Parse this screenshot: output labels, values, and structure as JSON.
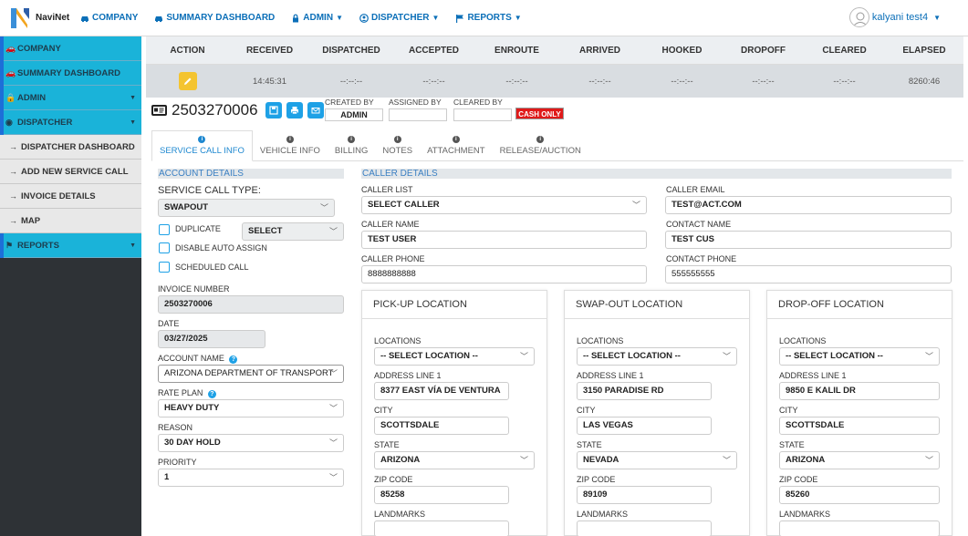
{
  "brand": {
    "name": "NaviNet"
  },
  "topnav": {
    "items": [
      {
        "label": "COMPANY",
        "icon": "car-icon",
        "dropdown": false
      },
      {
        "label": "SUMMARY DASHBOARD",
        "icon": "car-icon",
        "dropdown": false
      },
      {
        "label": "ADMIN",
        "icon": "lock-icon",
        "dropdown": true
      },
      {
        "label": "DISPATCHER",
        "icon": "user-circle-icon",
        "dropdown": true
      },
      {
        "label": "REPORTS",
        "icon": "flag-icon",
        "dropdown": true
      }
    ],
    "user": "kalyani test4"
  },
  "sidebar": {
    "items": [
      {
        "label": "COMPANY",
        "type": "main",
        "caret": false
      },
      {
        "label": "SUMMARY DASHBOARD",
        "type": "main",
        "caret": false
      },
      {
        "label": "ADMIN",
        "type": "main",
        "caret": true
      },
      {
        "label": "DISPATCHER",
        "type": "main",
        "caret": true
      },
      {
        "label": "DISPATCHER DASHBOARD",
        "type": "sub"
      },
      {
        "label": "ADD NEW SERVICE CALL",
        "type": "sub"
      },
      {
        "label": "INVOICE DETAILS",
        "type": "sub"
      },
      {
        "label": "MAP",
        "type": "sub"
      },
      {
        "label": "REPORTS",
        "type": "main",
        "caret": true
      }
    ]
  },
  "status_table": {
    "headers": [
      "ACTION",
      "RECEIVED",
      "DISPATCHED",
      "ACCEPTED",
      "ENROUTE",
      "ARRIVED",
      "HOOKED",
      "DROPOFF",
      "CLEARED",
      "ELAPSED"
    ],
    "row": [
      "",
      "14:45:31",
      "--:--:--",
      "--:--:--",
      "--:--:--",
      "--:--:--",
      "--:--:--",
      "--:--:--",
      "--:--:--",
      "8260:46"
    ]
  },
  "call": {
    "number": "2503270006",
    "created_by_label": "CREATED BY",
    "created_by": "ADMIN",
    "assigned_by_label": "ASSIGNED BY",
    "assigned_by": "",
    "cleared_by_label": "CLEARED BY",
    "cleared_by": "",
    "cash_badge": "CASH ONLY"
  },
  "tabs": [
    "SERVICE CALL INFO",
    "VEHICLE INFO",
    "BILLING",
    "NOTES",
    "ATTACHMENT",
    "RELEASE/AUCTION"
  ],
  "account": {
    "title": "ACCOUNT DETAILS",
    "service_call_type_label": "SERVICE CALL TYPE:",
    "service_call_type": "SWAPOUT",
    "duplicate_label": "DUPLICATE",
    "duplicate_select": "SELECT",
    "disable_auto_assign_label": "DISABLE AUTO ASSIGN",
    "scheduled_call_label": "SCHEDULED CALL",
    "invoice_number_label": "INVOICE NUMBER",
    "invoice_number": "2503270006",
    "date_label": "DATE",
    "date": "03/27/2025",
    "account_name_label": "ACCOUNT NAME",
    "account_name": "ARIZONA DEPARTMENT OF TRANSPORT",
    "rate_plan_label": "RATE PLAN",
    "rate_plan": "HEAVY DUTY",
    "reason_label": "REASON",
    "reason": "30 DAY HOLD",
    "priority_label": "PRIORITY",
    "priority": "1"
  },
  "caller": {
    "title": "CALLER DETAILS",
    "caller_list_label": "CALLER LIST",
    "caller_list": "SELECT CALLER",
    "caller_email_label": "CALLER EMAIL",
    "caller_email": "TEST@ACT.COM",
    "caller_name_label": "CALLER NAME",
    "caller_name": "TEST USER",
    "contact_name_label": "CONTACT NAME",
    "contact_name": "TEST CUS",
    "caller_phone_label": "CALLER PHONE",
    "caller_phone": "8888888888",
    "contact_phone_label": "CONTACT PHONE",
    "contact_phone": "555555555"
  },
  "locations": [
    {
      "title": "PICK-UP LOCATION",
      "locations_label": "LOCATIONS",
      "locations": "-- SELECT LOCATION --",
      "address_label": "ADDRESS LINE 1",
      "address": "8377 EAST VÍA DE VENTURA",
      "city_label": "CITY",
      "city": "SCOTTSDALE",
      "state_label": "STATE",
      "state": "ARIZONA",
      "zip_label": "ZIP CODE",
      "zip": "85258",
      "landmarks_label": "LANDMARKS"
    },
    {
      "title": "SWAP-OUT LOCATION",
      "locations_label": "LOCATIONS",
      "locations": "-- SELECT LOCATION --",
      "address_label": "ADDRESS LINE 1",
      "address": "3150 PARADISE RD",
      "city_label": "CITY",
      "city": "LAS VEGAS",
      "state_label": "STATE",
      "state": "NEVADA",
      "zip_label": "ZIP CODE",
      "zip": "89109",
      "landmarks_label": "LANDMARKS"
    },
    {
      "title": "DROP-OFF LOCATION",
      "locations_label": "LOCATIONS",
      "locations": "-- SELECT LOCATION --",
      "address_label": "ADDRESS LINE 1",
      "address": "9850 E KALIL DR",
      "city_label": "CITY",
      "city": "SCOTTSDALE",
      "state_label": "STATE",
      "state": "ARIZONA",
      "zip_label": "ZIP CODE",
      "zip": "85260",
      "landmarks_label": "LANDMARKS"
    }
  ],
  "colors": {
    "accent": "#1ab3d9",
    "link": "#0b6fb8",
    "sidebar_bg": "#2e3236",
    "cash": "#e01a1a",
    "edit": "#f4c430"
  }
}
